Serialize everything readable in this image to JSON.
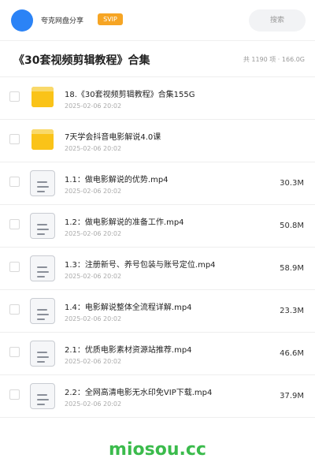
{
  "header": {
    "share_name": "夸克网盘分享",
    "badge": "SVIP",
    "search_label": "搜索",
    "brand_color": "#2b83f6",
    "badge_color": "#f6a524"
  },
  "title_bar": {
    "title": "《30套视频剪辑教程》合集",
    "stats": "共 1190 项 · 166.0G"
  },
  "files": [
    {
      "type": "folder-icon",
      "name": "18.《30套视频剪辑教程》合集155G",
      "date": "2025-02-06 20:02",
      "size": ""
    },
    {
      "type": "folder-icon",
      "name": "7天学会抖音电影解说4.0课",
      "date": "2025-02-06 20:02",
      "size": ""
    },
    {
      "type": "file-icon",
      "name": "1.1：做电影解说的优势.mp4",
      "date": "2025-02-06 20:02",
      "size": "30.3M"
    },
    {
      "type": "file-icon",
      "name": "1.2：做电影解说的准备工作.mp4",
      "date": "2025-02-06 20:02",
      "size": "50.8M"
    },
    {
      "type": "file-icon",
      "name": "1.3：注册新号、养号包装与账号定位.mp4",
      "date": "2025-02-06 20:02",
      "size": "58.9M"
    },
    {
      "type": "file-icon",
      "name": "1.4：电影解说整体全流程详解.mp4",
      "date": "2025-02-06 20:02",
      "size": "23.3M"
    },
    {
      "type": "file-icon",
      "name": "2.1：优质电影素材资源站推荐.mp4",
      "date": "2025-02-06 20:02",
      "size": "46.6M"
    },
    {
      "type": "file-icon",
      "name": "2.2：全网高清电影无水印免VIP下载.mp4",
      "date": "2025-02-06 20:02",
      "size": "37.9M"
    }
  ],
  "footer": {
    "watermark": "miosou.cc",
    "watermark_color": "#3bbb4c"
  }
}
